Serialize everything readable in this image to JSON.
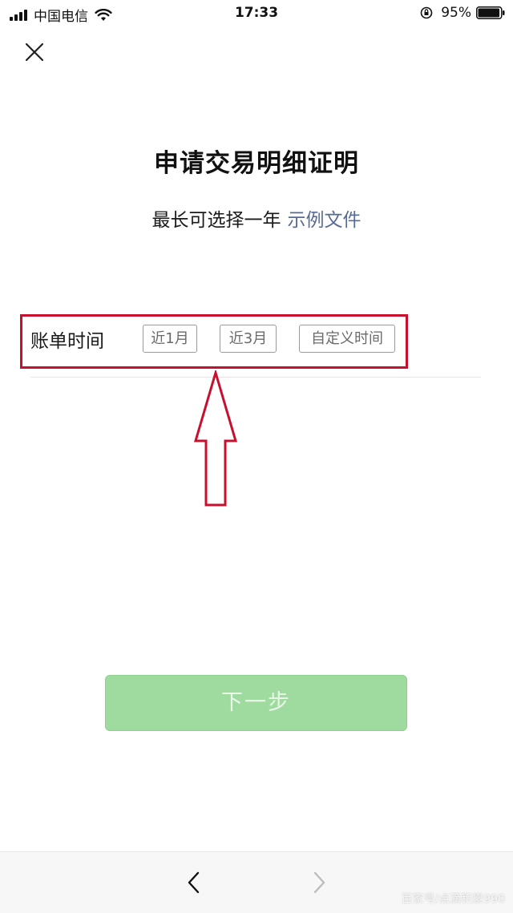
{
  "status_bar": {
    "carrier": "中国电信",
    "time": "17:33",
    "battery_percent": "95%",
    "battery_level": 0.95,
    "icons": [
      "signal-icon",
      "wifi-icon",
      "rotation-lock-icon",
      "battery-icon"
    ]
  },
  "header": {
    "close_icon": "close-icon"
  },
  "main": {
    "title": "申请交易明细证明",
    "subtitle": "最长可选择一年",
    "sample_link": "示例文件"
  },
  "bill_time": {
    "label": "账单时间",
    "options": [
      "近1月",
      "近3月",
      "自定义时间"
    ]
  },
  "next_button": {
    "label": "下一步"
  },
  "bottom_nav": {
    "back_icon": "chevron-left-icon",
    "forward_icon": "chevron-right-icon"
  },
  "watermark": "百家号/点滴积累990",
  "colors": {
    "link": "#576b95",
    "button_bg": "#9fdb9f",
    "annotation_red": "#c8102e"
  }
}
